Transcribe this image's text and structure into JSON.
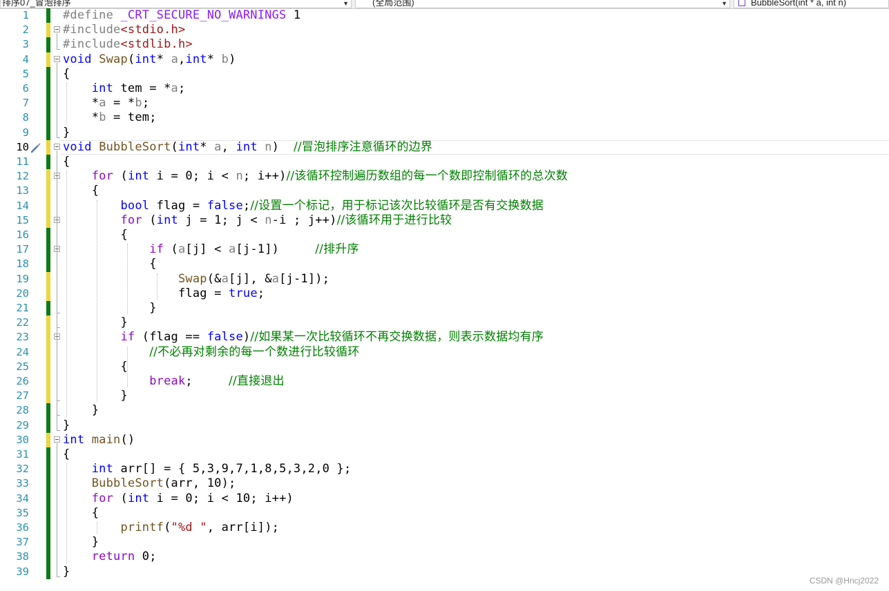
{
  "toolbar": {
    "project_dropdown": "排序07_冒泡排序",
    "scope_dropdown": "(全局范围)",
    "function_dropdown": "BubbleSort(int * a, int n)"
  },
  "editor": {
    "current_line": 10,
    "lines": [
      {
        "n": "1",
        "html": "<span class=\"pp\">#define </span><span class=\"mac\">_CRT_SECURE_NO_WARNINGS</span> 1"
      },
      {
        "n": "2",
        "html": "<span class=\"pp\">#include</span><span class=\"inc\">&lt;stdio.h&gt;</span>"
      },
      {
        "n": "3",
        "html": "<span class=\"pp\">#include</span><span class=\"inc\">&lt;stdlib.h&gt;</span>"
      },
      {
        "n": "4",
        "html": "<span class=\"kw\">void</span> <span class=\"fn\">Swap</span>(<span class=\"kw\">int</span>* <span class=\"par\">a</span>,<span class=\"kw\">int</span>* <span class=\"par\">b</span>)"
      },
      {
        "n": "5",
        "html": "{"
      },
      {
        "n": "6",
        "html": "    <span class=\"kw\">int</span> tem = *<span class=\"par\">a</span>;"
      },
      {
        "n": "7",
        "html": "    *<span class=\"par\">a</span> = *<span class=\"par\">b</span>;"
      },
      {
        "n": "8",
        "html": "    *<span class=\"par\">b</span> = tem;"
      },
      {
        "n": "9",
        "html": "}"
      },
      {
        "n": "10",
        "html": "<span class=\"kw\">void</span> <span class=\"fn\">BubbleSort</span>(<span class=\"kw\">int</span>* <span class=\"par\">a</span>, <span class=\"kw\">int</span> <span class=\"par\">n</span>)  <span class=\"cmt\">//冒泡排序注意循环的边界</span>"
      },
      {
        "n": "11",
        "html": "{"
      },
      {
        "n": "12",
        "html": "    <span class=\"ctl\">for</span> (<span class=\"kw\">int</span> i = 0; i &lt; <span class=\"par\">n</span>; i++)<span class=\"cmt\">//该循环控制遍历数组的每一个数即控制循环的总次数</span>"
      },
      {
        "n": "13",
        "html": "    {"
      },
      {
        "n": "14",
        "html": "        <span class=\"kw\">bool</span> flag = <span class=\"kw\">false</span>;<span class=\"cmt\">//设置一个标记，用于标记该次比较循环是否有交换数据</span>"
      },
      {
        "n": "15",
        "html": "        <span class=\"ctl\">for</span> (<span class=\"kw\">int</span> j = 1; j &lt; <span class=\"par\">n</span>-i ; j++)<span class=\"cmt\">//该循环用于进行比较</span>"
      },
      {
        "n": "16",
        "html": "        {"
      },
      {
        "n": "17",
        "html": "            <span class=\"ctl\">if</span> (<span class=\"par\">a</span>[j] &lt; <span class=\"par\">a</span>[j-1])     <span class=\"cmt\">//排升序</span>"
      },
      {
        "n": "18",
        "html": "            {"
      },
      {
        "n": "19",
        "html": "                <span class=\"fn\">Swap</span>(&amp;<span class=\"par\">a</span>[j], &amp;<span class=\"par\">a</span>[j-1]);"
      },
      {
        "n": "20",
        "html": "                flag = <span class=\"kw\">true</span>;"
      },
      {
        "n": "21",
        "html": "            }"
      },
      {
        "n": "22",
        "html": "        }"
      },
      {
        "n": "23",
        "html": "        <span class=\"ctl\">if</span> (flag == <span class=\"kw\">false</span>)<span class=\"cmt\">//如果某一次比较循环不再交换数据，则表示数据均有序</span>"
      },
      {
        "n": "24",
        "html": "            <span class=\"cmt\">//不必再对剩余的每一个数进行比较循环</span>"
      },
      {
        "n": "25",
        "html": "        {"
      },
      {
        "n": "26",
        "html": "            <span class=\"ctl\">break</span>;     <span class=\"cmt\">//直接退出</span>"
      },
      {
        "n": "27",
        "html": "        }"
      },
      {
        "n": "28",
        "html": "    }"
      },
      {
        "n": "29",
        "html": "}"
      },
      {
        "n": "30",
        "html": "<span class=\"kw\">int</span> <span class=\"fn\">main</span>()"
      },
      {
        "n": "31",
        "html": "{"
      },
      {
        "n": "32",
        "html": "    <span class=\"kw\">int</span> arr[] = { 5,3,9,7,1,8,5,3,2,0 };"
      },
      {
        "n": "33",
        "html": "    <span class=\"fn\">BubbleSort</span>(arr, 10);"
      },
      {
        "n": "34",
        "html": "    <span class=\"ctl\">for</span> (<span class=\"kw\">int</span> i = 0; i &lt; 10; i++)"
      },
      {
        "n": "35",
        "html": "    {"
      },
      {
        "n": "36",
        "html": "        <span class=\"fn\">printf</span>(<span class=\"str\">\"%d \"</span>, arr[i]);"
      },
      {
        "n": "37",
        "html": "    }"
      },
      {
        "n": "38",
        "html": "    <span class=\"ctl\">return</span> 0;"
      },
      {
        "n": "39",
        "html": "}"
      }
    ],
    "change_markers": [
      "saved",
      "unsaved",
      "saved",
      "unsaved",
      "saved",
      "saved",
      "saved",
      "saved",
      "saved",
      "unsaved",
      "saved",
      "unsaved",
      "unsaved",
      "unsaved",
      "unsaved",
      "saved",
      "saved",
      "saved",
      "unsaved",
      "unsaved",
      "saved",
      "unsaved",
      "unsaved",
      "unsaved",
      "unsaved",
      "unsaved",
      "unsaved",
      "saved",
      "saved",
      "unsaved",
      "saved",
      "saved",
      "saved",
      "saved",
      "saved",
      "saved",
      "saved",
      "saved",
      "saved"
    ],
    "fold_lines": [
      2,
      4,
      10,
      12,
      15,
      17,
      23,
      30
    ]
  },
  "watermark": "CSDN @Hncj2022"
}
